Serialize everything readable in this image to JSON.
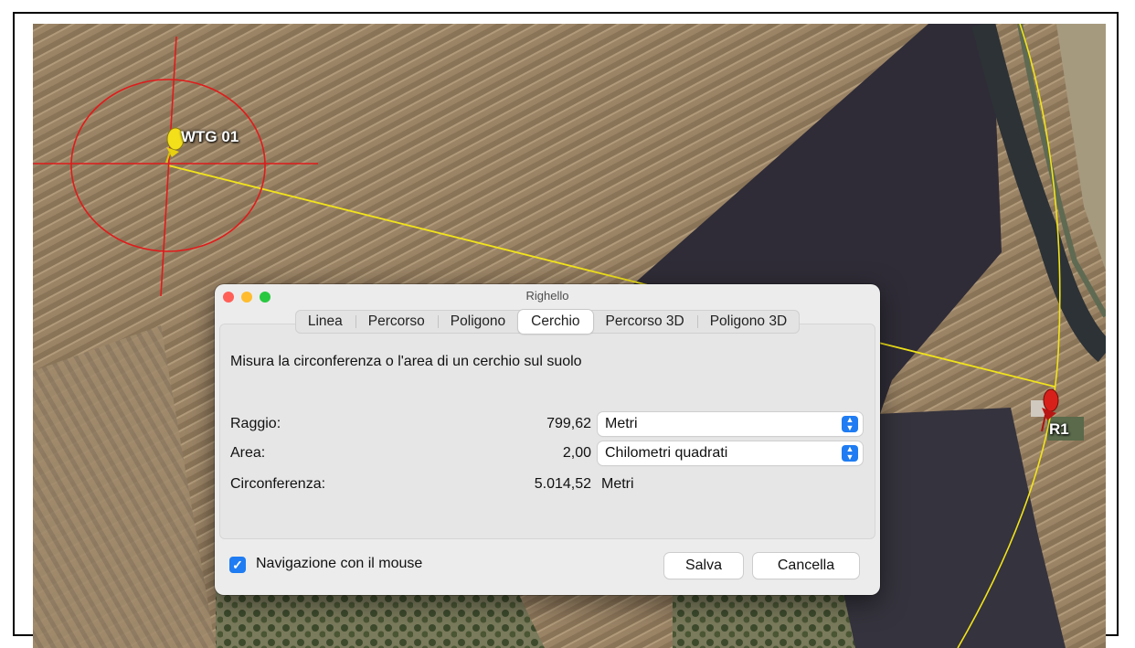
{
  "map": {
    "pins": [
      {
        "label": "WTG 01",
        "color": "#f4e01a"
      },
      {
        "label": "R1",
        "color": "#d8201a"
      }
    ],
    "colors": {
      "circle": "#e01b1b",
      "ruler_line": "#f2e41a"
    }
  },
  "dialog": {
    "title": "Righello",
    "tabs": [
      "Linea",
      "Percorso",
      "Poligono",
      "Cerchio",
      "Percorso 3D",
      "Poligono 3D"
    ],
    "active_tab": "Cerchio",
    "description": "Misura la circonferenza o l'area di un cerchio sul suolo",
    "rows": {
      "raggio": {
        "label": "Raggio:",
        "value": "799,62",
        "unit": "Metri"
      },
      "area": {
        "label": "Area:",
        "value": "2,00",
        "unit": "Chilometri quadrati"
      },
      "circonferenza": {
        "label": "Circonferenza:",
        "value": "5.014,52",
        "unit": "Metri"
      }
    },
    "mouse_nav": {
      "label": "Navigazione con il mouse",
      "checked": true
    },
    "buttons": {
      "save": "Salva",
      "cancel": "Cancella"
    },
    "accent": "#1f7cf2"
  }
}
